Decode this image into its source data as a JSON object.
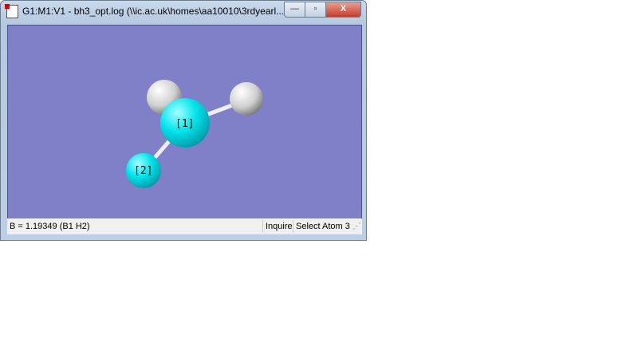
{
  "window": {
    "title": "G1:M1:V1 - bh3_opt.log (\\\\ic.ac.uk\\homes\\aa10010\\3rdyearl...",
    "buttons": {
      "minimize": "—",
      "maximize": "▫",
      "close": "X"
    }
  },
  "molecule": {
    "atoms": [
      {
        "label": "[1]",
        "element": "B"
      },
      {
        "label": "[2]",
        "element": "H"
      }
    ],
    "colors": {
      "boron": "#00e0e8",
      "hydrogen": "#dcdcdc",
      "background": "#8080c8"
    }
  },
  "status": {
    "message": "B = 1.19349 (B1 H2)",
    "mode": "Inquire",
    "prompt": "Select Atom 3"
  }
}
